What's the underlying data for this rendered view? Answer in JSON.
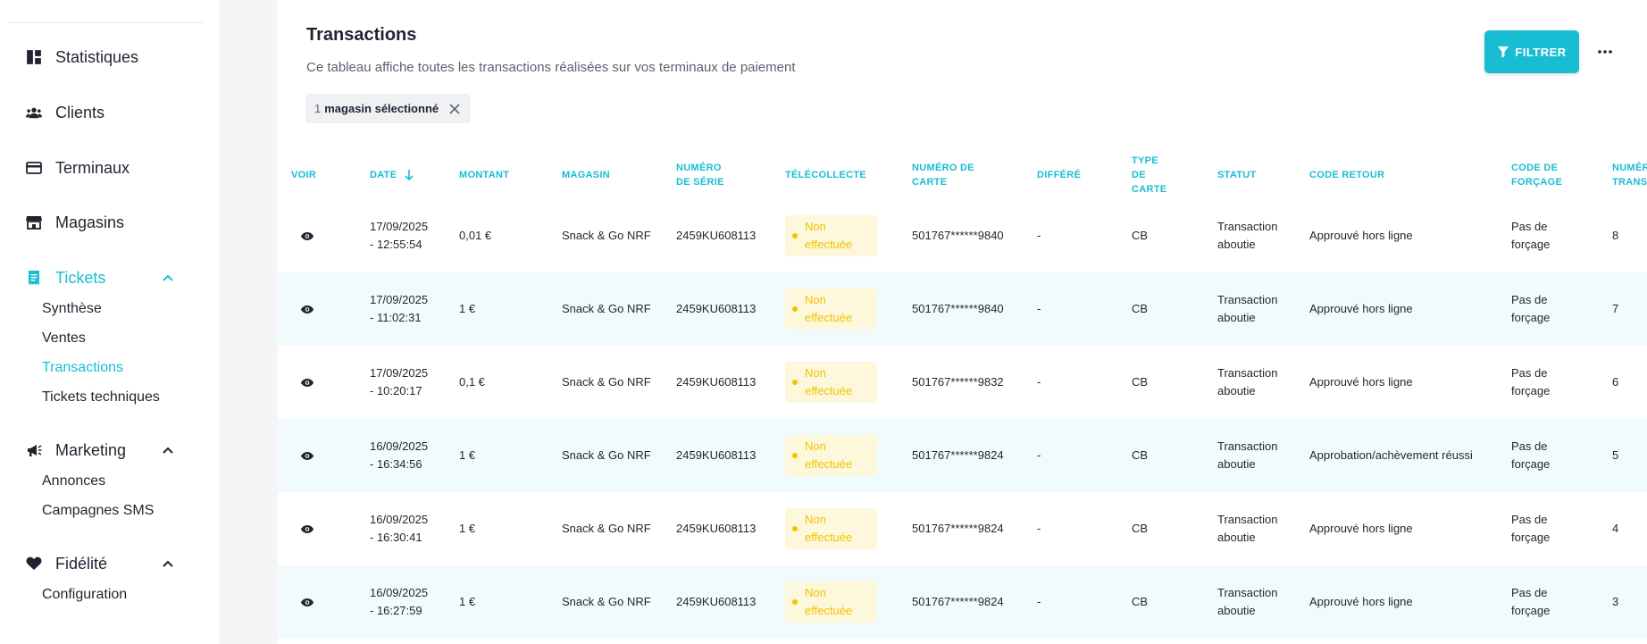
{
  "sidebar": {
    "items": [
      {
        "label": "Statistiques",
        "icon": "dashboard-icon"
      },
      {
        "label": "Clients",
        "icon": "users-icon"
      },
      {
        "label": "Terminaux",
        "icon": "credit-card-icon"
      },
      {
        "label": "Magasins",
        "icon": "store-icon"
      },
      {
        "label": "Tickets",
        "icon": "receipt-icon"
      },
      {
        "label": "Marketing",
        "icon": "megaphone-icon"
      },
      {
        "label": "Fidélité",
        "icon": "heart-icon"
      }
    ],
    "tickets_sub": [
      "Synthèse",
      "Ventes",
      "Transactions",
      "Tickets techniques"
    ],
    "marketing_sub": [
      "Annonces",
      "Campagnes SMS"
    ],
    "fidelite_sub": [
      "Configuration"
    ]
  },
  "header": {
    "title": "Transactions",
    "subtitle": "Ce tableau affiche toutes les transactions réalisées sur vos terminaux de paiement",
    "filter_label": "FILTRER",
    "chip_count": "1",
    "chip_label": "magasin sélectionné"
  },
  "table": {
    "columns": [
      {
        "line1": "VOIR",
        "line2": ""
      },
      {
        "line1": "DATE",
        "line2": ""
      },
      {
        "line1": "MONTANT",
        "line2": ""
      },
      {
        "line1": "MAGASIN",
        "line2": ""
      },
      {
        "line1": "NUMÉRO",
        "line2": "DE SÉRIE"
      },
      {
        "line1": "TÉLÉCOLLECTE",
        "line2": ""
      },
      {
        "line1": "NUMÉRO DE",
        "line2": "CARTE"
      },
      {
        "line1": "DIFFÉRÉ",
        "line2": ""
      },
      {
        "line1": "TYPE",
        "line2": "DE",
        "line3": "CARTE"
      },
      {
        "line1": "STATUT",
        "line2": ""
      },
      {
        "line1": "CODE RETOUR",
        "line2": ""
      },
      {
        "line1": "CODE DE",
        "line2": "FORÇAGE"
      },
      {
        "line1": "NUMÉR",
        "line2": "TRANS"
      }
    ],
    "rows": [
      {
        "date1": "17/09/2025",
        "date2": "- 12:55:54",
        "montant": "0,01 €",
        "magasin": "Snack & Go NRF",
        "serie": "2459KU608113",
        "tele1": "Non",
        "tele2": "effectuée",
        "carte": "501767******9840",
        "differe": "-",
        "type": "CB",
        "statut1": "Transaction",
        "statut2": "aboutie",
        "code": "Approuvé hors ligne",
        "force1": "Pas de",
        "force2": "forçage",
        "num": "8"
      },
      {
        "date1": "17/09/2025",
        "date2": "- 11:02:31",
        "montant": "1 €",
        "magasin": "Snack & Go NRF",
        "serie": "2459KU608113",
        "tele1": "Non",
        "tele2": "effectuée",
        "carte": "501767******9840",
        "differe": "-",
        "type": "CB",
        "statut1": "Transaction",
        "statut2": "aboutie",
        "code": "Approuvé hors ligne",
        "force1": "Pas de",
        "force2": "forçage",
        "num": "7"
      },
      {
        "date1": "17/09/2025",
        "date2": "- 10:20:17",
        "montant": "0,1 €",
        "magasin": "Snack & Go NRF",
        "serie": "2459KU608113",
        "tele1": "Non",
        "tele2": "effectuée",
        "carte": "501767******9832",
        "differe": "-",
        "type": "CB",
        "statut1": "Transaction",
        "statut2": "aboutie",
        "code": "Approuvé hors ligne",
        "force1": "Pas de",
        "force2": "forçage",
        "num": "6"
      },
      {
        "date1": "16/09/2025",
        "date2": "- 16:34:56",
        "montant": "1 €",
        "magasin": "Snack & Go NRF",
        "serie": "2459KU608113",
        "tele1": "Non",
        "tele2": "effectuée",
        "carte": "501767******9824",
        "differe": "-",
        "type": "CB",
        "statut1": "Transaction",
        "statut2": "aboutie",
        "code": "Approbation/achèvement réussi",
        "force1": "Pas de",
        "force2": "forçage",
        "num": "5"
      },
      {
        "date1": "16/09/2025",
        "date2": "- 16:30:41",
        "montant": "1 €",
        "magasin": "Snack & Go NRF",
        "serie": "2459KU608113",
        "tele1": "Non",
        "tele2": "effectuée",
        "carte": "501767******9824",
        "differe": "-",
        "type": "CB",
        "statut1": "Transaction",
        "statut2": "aboutie",
        "code": "Approuvé hors ligne",
        "force1": "Pas de",
        "force2": "forçage",
        "num": "4"
      },
      {
        "date1": "16/09/2025",
        "date2": "- 16:27:59",
        "montant": "1 €",
        "magasin": "Snack & Go NRF",
        "serie": "2459KU608113",
        "tele1": "Non",
        "tele2": "effectuée",
        "carte": "501767******9824",
        "differe": "-",
        "type": "CB",
        "statut1": "Transaction",
        "statut2": "aboutie",
        "code": "Approuvé hors ligne",
        "force1": "Pas de",
        "force2": "forçage",
        "num": "3"
      }
    ]
  },
  "colors": {
    "accent": "#19bdd3",
    "pending": "#f1c400",
    "pending_bg": "#fdf7dc",
    "row_alt": "#f2fbfc"
  }
}
